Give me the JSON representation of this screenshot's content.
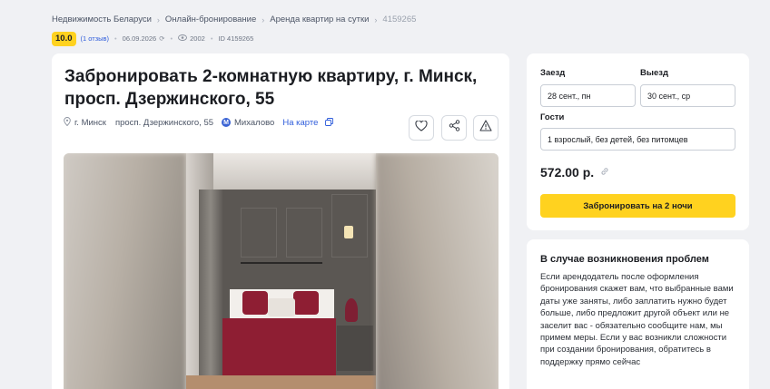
{
  "breadcrumb": {
    "items": [
      "Недвижимость Беларуси",
      "Онлайн-бронирование",
      "Аренда квартир на сутки"
    ],
    "current": "4159265"
  },
  "meta": {
    "rating": "10.0",
    "reviews": "(1 отзыв)",
    "date": "06.09.2026",
    "views": "2002",
    "id": "ID 4159265"
  },
  "listing": {
    "title": "Забронировать 2-комнатную квартиру, г. Минск, просп. Дзержинского, 55",
    "city": "г. Минск",
    "street": "просп. Дзержинского, 55",
    "metro_badge": "М",
    "metro": "Михалово",
    "map_link": "На карте"
  },
  "booking": {
    "checkin_label": "Заезд",
    "checkin_value": "28 сент., пн",
    "checkout_label": "Выезд",
    "checkout_value": "30 сент., ср",
    "guests_label": "Гости",
    "guests_value": "1 взрослый, без детей, без питомцев",
    "price": "572.00 р.",
    "button": "Забронировать на 2 ночи"
  },
  "help": {
    "title": "В случае возникновения проблем",
    "text": "Если арендодатель после оформления бронирования скажет вам, что выбранные вами даты уже заняты, либо заплатить нужно будет больше, либо предложит другой объект или не заселит вас - обязательно сообщите нам, мы примем меры. Если у вас возникли сложности при создании бронирования, обратитесь в поддержку прямо сейчас"
  },
  "colors": {
    "accent_yellow": "#ffd21f",
    "link_blue": "#2e5cdb",
    "page_bg": "#f0f1f4"
  }
}
